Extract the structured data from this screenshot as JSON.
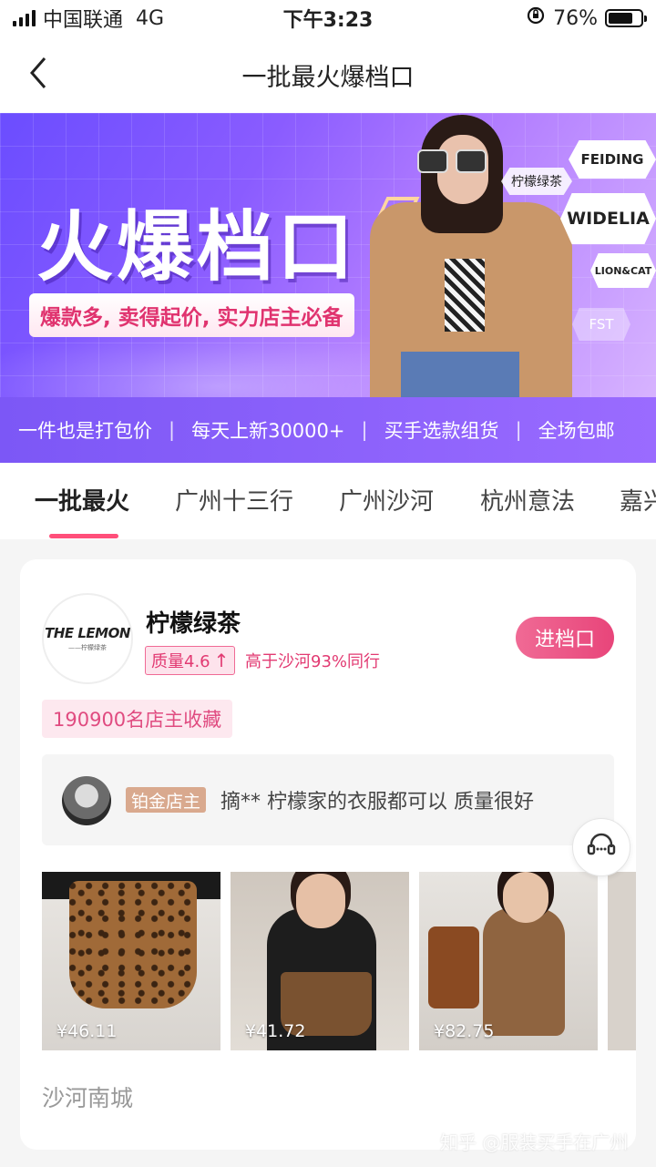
{
  "status_bar": {
    "carrier": "中国联通",
    "network": "4G",
    "time": "下午3:23",
    "battery_percent": "76%",
    "battery_level": 0.76
  },
  "nav": {
    "title": "一批最火爆档口",
    "back_icon": "chevron-left-icon"
  },
  "banner": {
    "headline": "火爆档口",
    "subline": "爆款多, 卖得起价, 实力店主必备",
    "brand_tags": [
      "FEIDING",
      "WIDELIA",
      "LION&CAT",
      "FST",
      "柠檬绿茶"
    ]
  },
  "features": [
    "一件也是打包价",
    "每天上新30000+",
    "买手选款组货",
    "全场包邮"
  ],
  "tabs": [
    {
      "label": "一批最火",
      "active": true
    },
    {
      "label": "广州十三行",
      "active": false
    },
    {
      "label": "广州沙河",
      "active": false
    },
    {
      "label": "杭州意法",
      "active": false
    },
    {
      "label": "嘉兴",
      "active": false
    }
  ],
  "shop": {
    "logo_text": "THE LEMON",
    "logo_subtext": "——柠檬绿茶",
    "name": "柠檬绿茶",
    "quality": "质量4.6",
    "quality_arrow": "↑",
    "compare": "高于沙河93%同行",
    "enter_label": "进档口",
    "favorites": "190900名店主收藏",
    "review": {
      "level": "铂金店主",
      "text": "摘** 柠檬家的衣服都可以 质量很好"
    },
    "products": [
      {
        "price": "¥46.11"
      },
      {
        "price": "¥41.72"
      },
      {
        "price": "¥82.75"
      }
    ],
    "district": "沙河南城"
  },
  "watermark": "知乎 @服装买手在广州",
  "colors": {
    "accent_pink": "#e8457a",
    "banner_purple": "#7c57f6"
  }
}
